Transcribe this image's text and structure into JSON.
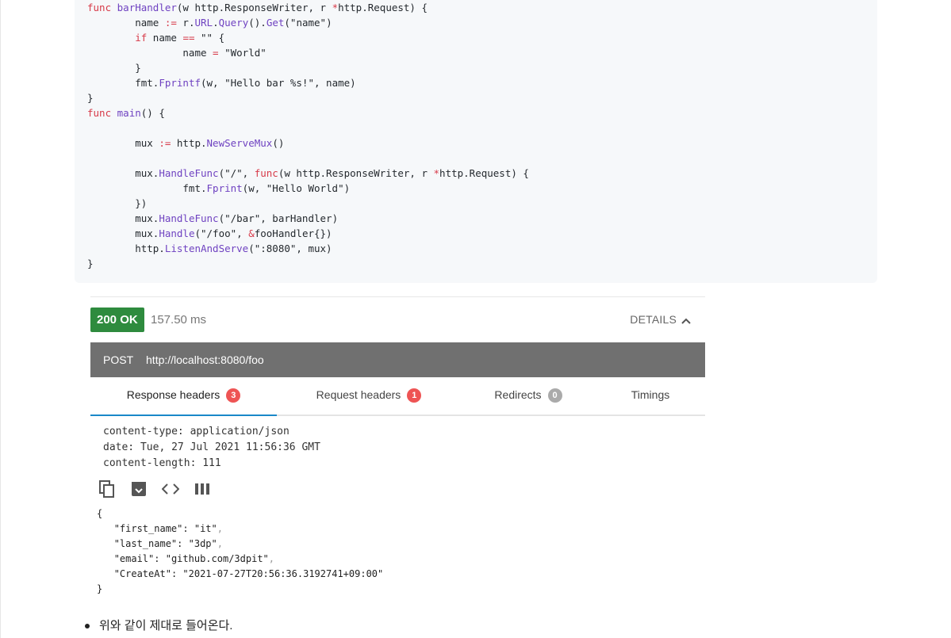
{
  "code": {
    "lines": [
      "func barHandler(w http.ResponseWriter, r *http.Request) {",
      "        name := r.URL.Query().Get(\"name\")",
      "        if name == \"\" {",
      "                name = \"World\"",
      "        }",
      "        fmt.Fprintf(w, \"Hello bar %s!\", name)",
      "}",
      "func main() {",
      "",
      "        mux := http.NewServeMux()",
      "",
      "        mux.HandleFunc(\"/\", func(w http.ResponseWriter, r *http.Request) {",
      "                fmt.Fprint(w, \"Hello World\")",
      "        })",
      "        mux.HandleFunc(\"/bar\", barHandler)",
      "        mux.Handle(\"/foo\", &fooHandler{})",
      "        http.ListenAndServe(\":8080\", mux)",
      "}"
    ]
  },
  "response": {
    "status": "200 OK",
    "elapsed": "157.50 ms",
    "details_label": "DETAILS",
    "method": "POST",
    "url": "http://localhost:8080/foo"
  },
  "tabs": [
    {
      "label": "Response headers",
      "count": "3"
    },
    {
      "label": "Request headers",
      "count": "1"
    },
    {
      "label": "Redirects",
      "count": "0"
    },
    {
      "label": "Timings",
      "count": ""
    }
  ],
  "headers": [
    "content-type: application/json",
    "date: Tue, 27 Jul 2021 11:56:36 GMT",
    "content-length: 111"
  ],
  "json_body": {
    "open": "{",
    "fields": [
      {
        "key": "\"first_name\"",
        "value": "\"it\""
      },
      {
        "key": "\"last_name\"",
        "value": "\"3dp\""
      },
      {
        "key": "\"email\"",
        "value": "\"github.com/3dpit\""
      },
      {
        "key": "\"CreateAt\"",
        "value": "\"2021-07-27T20:56:36.3192741+09:00\""
      }
    ],
    "close": "}"
  },
  "bullet_text": "위와 같이 제대로 들어온다.",
  "colors": {
    "status_green": "#2e8b3e",
    "request_bar": "#707070",
    "active_tab_underline": "#1a88c9",
    "badge_red": "#ee5454",
    "badge_gray": "#aaaaaa"
  }
}
